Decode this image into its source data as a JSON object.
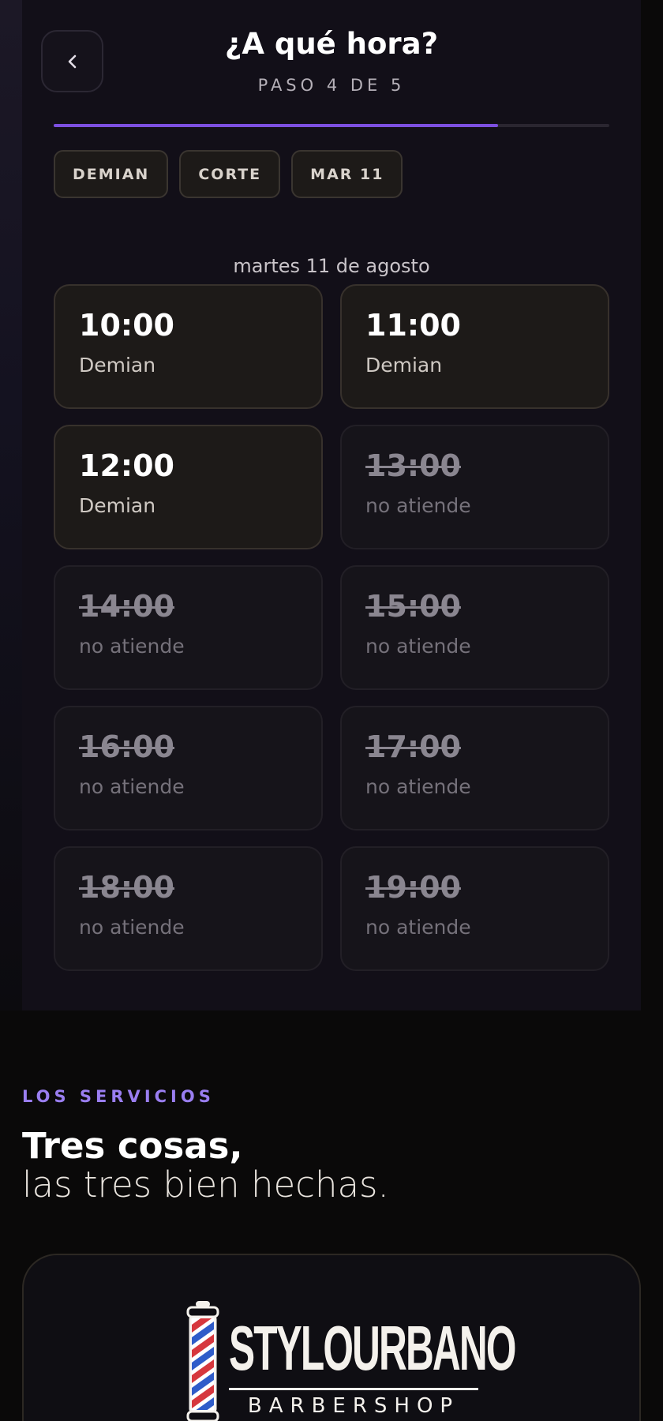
{
  "header": {
    "title": "¿A qué hora?",
    "step": "PASO 4 DE 5",
    "progress": 0.8
  },
  "chips": [
    {
      "label": "DEMIAN"
    },
    {
      "label": "CORTE"
    },
    {
      "label": "MAR 11"
    }
  ],
  "date_label": "martes 11 de agosto",
  "slots": [
    {
      "time": "10:00",
      "note": "Demian",
      "available": true
    },
    {
      "time": "11:00",
      "note": "Demian",
      "available": true
    },
    {
      "time": "12:00",
      "note": "Demian",
      "available": true
    },
    {
      "time": "13:00",
      "note": "no atiende",
      "available": false
    },
    {
      "time": "14:00",
      "note": "no atiende",
      "available": false
    },
    {
      "time": "15:00",
      "note": "no atiende",
      "available": false
    },
    {
      "time": "16:00",
      "note": "no atiende",
      "available": false
    },
    {
      "time": "17:00",
      "note": "no atiende",
      "available": false
    },
    {
      "time": "18:00",
      "note": "no atiende",
      "available": false
    },
    {
      "time": "19:00",
      "note": "no atiende",
      "available": false
    }
  ],
  "services": {
    "eyebrow": "LOS SERVICIOS",
    "title": "Tres cosas,",
    "subtitle": "las tres bien hechas."
  },
  "brand": {
    "name": "STYLOURBANO",
    "tagline": "BARBERSHOP"
  },
  "colors": {
    "accent": "#7c4fe0",
    "eyebrow": "#9a7ef0",
    "background": "#0a0909",
    "panel": "#120f18"
  },
  "icons": {
    "back": "chevron-left-icon",
    "logo": "barber-pole-icon"
  }
}
